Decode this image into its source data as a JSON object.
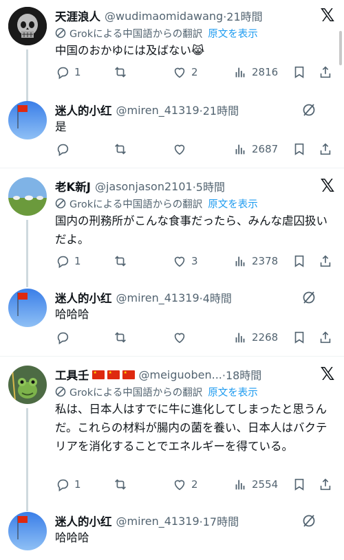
{
  "translation_label": "Grokによる中国語からの翻訳",
  "show_original": "原文を表示",
  "posts": [
    {
      "name": "天涯浪人",
      "handle": "@wudimaomidawang",
      "time": "·21時間",
      "text": "中国のおかゆには及ばない😹",
      "replies": "1",
      "retweets": "",
      "likes": "2",
      "views": "2816"
    },
    {
      "name": "迷人的小红",
      "handle": "@miren_41319",
      "time": "·21時間",
      "text": "是",
      "replies": "",
      "retweets": "",
      "likes": "",
      "views": "2687"
    },
    {
      "name": "老K新J",
      "handle": "@jasonjason2101",
      "time": "·5時間",
      "text": "国内の刑務所がこんな食事だったら、みんな虐囚扱いだよ。",
      "replies": "1",
      "retweets": "",
      "likes": "3",
      "views": "2378"
    },
    {
      "name": "迷人的小红",
      "handle": "@miren_41319",
      "time": "·4時間",
      "text": "哈哈哈",
      "replies": "",
      "retweets": "",
      "likes": "",
      "views": "2268"
    },
    {
      "name": "工具壬",
      "handle": "@meiguoben...",
      "time": "·18時間",
      "text": "私は、日本人はすでに牛に進化してしまったと思うんだ。これらの材料が腸内の菌を養い、日本人はバクテリアを消化することでエネルギーを得ている。",
      "replies": "1",
      "retweets": "",
      "likes": "2",
      "views": "2554"
    },
    {
      "name": "迷人的小红",
      "handle": "@miren_41319",
      "time": "·17時間",
      "text": "哈哈哈",
      "replies": "",
      "retweets": "",
      "likes": "",
      "views": ""
    }
  ],
  "colors": {
    "link": "#1d9bf0",
    "muted": "#536471",
    "line": "#cfd9de",
    "flag_red": "#de2910"
  },
  "icons": [
    "x-logo-icon",
    "grok-translate-icon",
    "grok-off-icon",
    "reply-icon",
    "retweet-icon",
    "like-icon",
    "views-icon",
    "bookmark-icon",
    "share-icon"
  ]
}
